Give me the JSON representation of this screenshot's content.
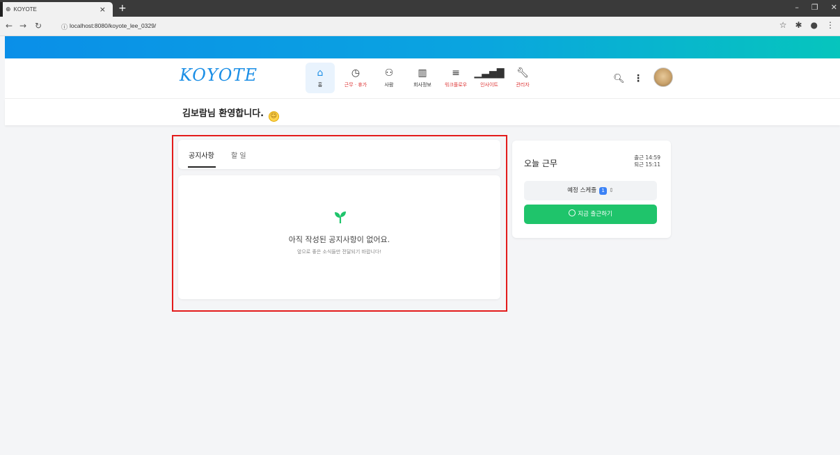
{
  "browser": {
    "tab_title": "KOYOTE",
    "tab_favicon": "globe-icon",
    "url": "localhost:8080/koyote_lee_0329/"
  },
  "header": {
    "logo": "KOYOTE",
    "nav": [
      {
        "label": "홈",
        "icon": "home-icon"
      },
      {
        "label": "근무 · 휴가",
        "icon": "clock-icon"
      },
      {
        "label": "사람",
        "icon": "users-icon"
      },
      {
        "label": "회사정보",
        "icon": "building-icon"
      },
      {
        "label": "워크플로우",
        "icon": "list-icon"
      },
      {
        "label": "인사이트",
        "icon": "signal-icon"
      },
      {
        "label": "관리자",
        "icon": "wrench-icon"
      }
    ]
  },
  "welcome": {
    "text": "김보람님 환영합니다."
  },
  "notice": {
    "tabs": [
      "공지사항",
      "할 일"
    ],
    "empty_title": "아직 작성된 공지사항이 없어요.",
    "empty_sub": "앞으로 좋은 소식들만 전달되기 바랍니다!"
  },
  "work": {
    "title": "오늘 근무",
    "checkin": "출근 14:59",
    "checkout": "퇴근 15:11",
    "schedule_label": "예정 스케줄",
    "schedule_count": "1",
    "checkin_button": "지금 출근하기"
  },
  "colors": {
    "accent": "#1a8ee6",
    "green": "#1fc46b",
    "highlight": "#e31b1b"
  }
}
